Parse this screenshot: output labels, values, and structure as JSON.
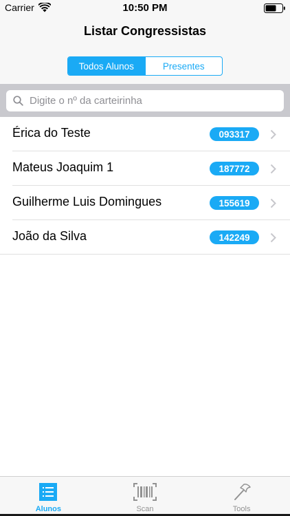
{
  "status_bar": {
    "carrier": "Carrier",
    "time": "10:50 PM"
  },
  "nav": {
    "title": "Listar Congressistas",
    "segments": [
      "Todos Alunos",
      "Presentes"
    ],
    "selected_segment": "Todos Alunos"
  },
  "search": {
    "placeholder": "Digite o nº da carteirinha"
  },
  "students": [
    {
      "name": "Érica do Teste",
      "id": "093317"
    },
    {
      "name": "Mateus Joaquim 1",
      "id": "187772"
    },
    {
      "name": "Guilherme Luis Domingues",
      "id": "155619"
    },
    {
      "name": "João da Silva",
      "id": "142249"
    }
  ],
  "tab_bar": {
    "tabs": [
      {
        "label": "Alunos",
        "icon": "list-icon",
        "active": true
      },
      {
        "label": "Scan",
        "icon": "barcode-icon",
        "active": false
      },
      {
        "label": "Tools",
        "icon": "hammer-icon",
        "active": false
      }
    ]
  },
  "colors": {
    "accent": "#1aaaf5",
    "bar_background": "#f7f7f7",
    "search_background": "#c9c9ce"
  }
}
